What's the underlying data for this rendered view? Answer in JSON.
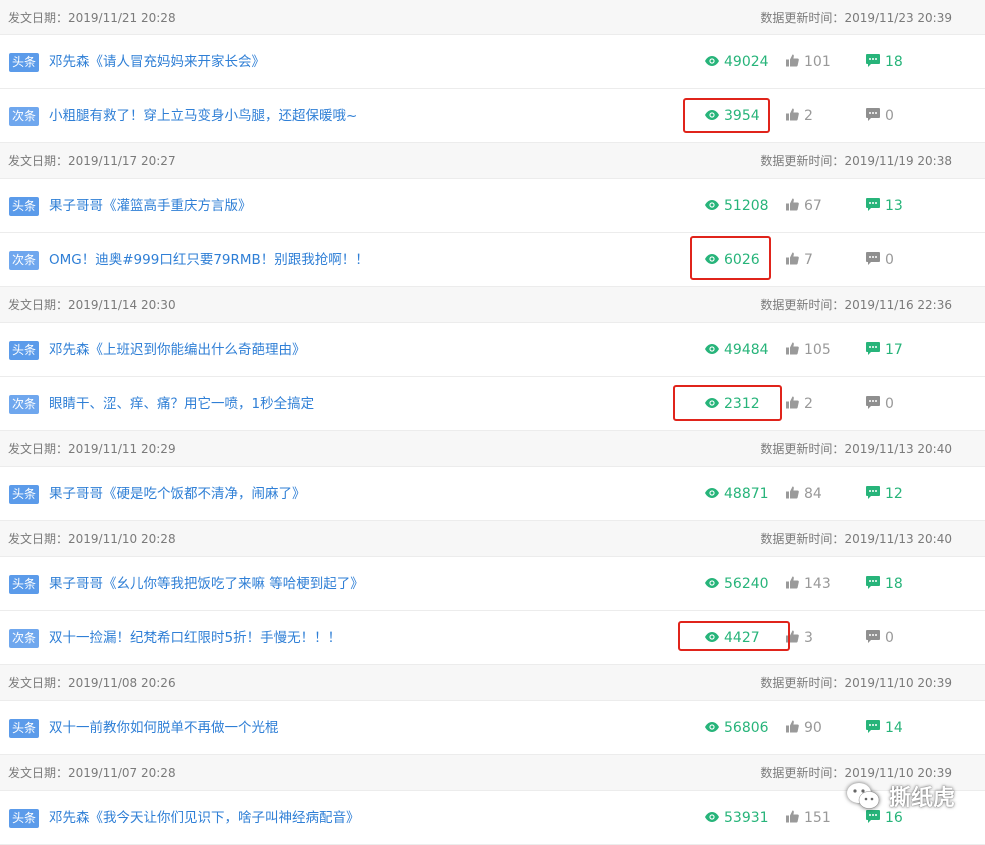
{
  "labels": {
    "publish_prefix": "发文日期：",
    "update_prefix": "数据更新时间："
  },
  "tag_labels": {
    "primary": "头条",
    "secondary": "次条"
  },
  "groups": [
    {
      "publish_date": "2019/11/21 20:28",
      "update_time": "2019/11/23 20:39",
      "articles": [
        {
          "tag": "头条",
          "title": "邓先森《请人冒充妈妈来开家长会》",
          "views": "49024",
          "likes": "101",
          "comments": "18"
        },
        {
          "tag": "次条",
          "title": "小粗腿有救了！穿上立马变身小鸟腿，还超保暖哦~",
          "views": "3954",
          "likes": "2",
          "comments": "0",
          "highlighted": true
        }
      ]
    },
    {
      "publish_date": "2019/11/17 20:27",
      "update_time": "2019/11/19 20:38",
      "articles": [
        {
          "tag": "头条",
          "title": "果子哥哥《灌篮高手重庆方言版》",
          "views": "51208",
          "likes": "67",
          "comments": "13"
        },
        {
          "tag": "次条",
          "title": "OMG！迪奥#999口红只要79RMB！别跟我抢啊！！",
          "views": "6026",
          "likes": "7",
          "comments": "0",
          "highlighted": true
        }
      ]
    },
    {
      "publish_date": "2019/11/14 20:30",
      "update_time": "2019/11/16 22:36",
      "articles": [
        {
          "tag": "头条",
          "title": "邓先森《上班迟到你能编出什么奇葩理由》",
          "views": "49484",
          "likes": "105",
          "comments": "17"
        },
        {
          "tag": "次条",
          "title": "眼睛干、涩、痒、痛？用它一喷，1秒全搞定",
          "views": "2312",
          "likes": "2",
          "comments": "0",
          "highlighted": true
        }
      ]
    },
    {
      "publish_date": "2019/11/11 20:29",
      "update_time": "2019/11/13 20:40",
      "articles": [
        {
          "tag": "头条",
          "title": "果子哥哥《硬是吃个饭都不清净，闹麻了》",
          "views": "48871",
          "likes": "84",
          "comments": "12"
        }
      ]
    },
    {
      "publish_date": "2019/11/10 20:28",
      "update_time": "2019/11/13 20:40",
      "articles": [
        {
          "tag": "头条",
          "title": "果子哥哥《幺儿你等我把饭吃了来嘛 等哈梗到起了》",
          "views": "56240",
          "likes": "143",
          "comments": "18"
        },
        {
          "tag": "次条",
          "title": "双十一捡漏！纪梵希口红限时5折！手慢无！！！",
          "views": "4427",
          "likes": "3",
          "comments": "0",
          "highlighted": true
        }
      ]
    },
    {
      "publish_date": "2019/11/08 20:26",
      "update_time": "2019/11/10 20:39",
      "articles": [
        {
          "tag": "头条",
          "title": "双十一前教你如何脱单不再做一个光棍",
          "views": "56806",
          "likes": "90",
          "comments": "14"
        }
      ]
    },
    {
      "publish_date": "2019/11/07 20:28",
      "update_time": "2019/11/10 20:39",
      "articles": [
        {
          "tag": "头条",
          "title": "邓先森《我今天让你们见识下，啥子叫神经病配音》",
          "views": "53931",
          "likes": "151",
          "comments": "16"
        }
      ]
    }
  ],
  "watermark": {
    "text": "撕纸虎",
    "icon": "wechat-icon"
  },
  "colors": {
    "views": "#27b47a",
    "title": "#2f7fd6",
    "highlight": "#e0241b",
    "tag": "#5b9bea"
  }
}
